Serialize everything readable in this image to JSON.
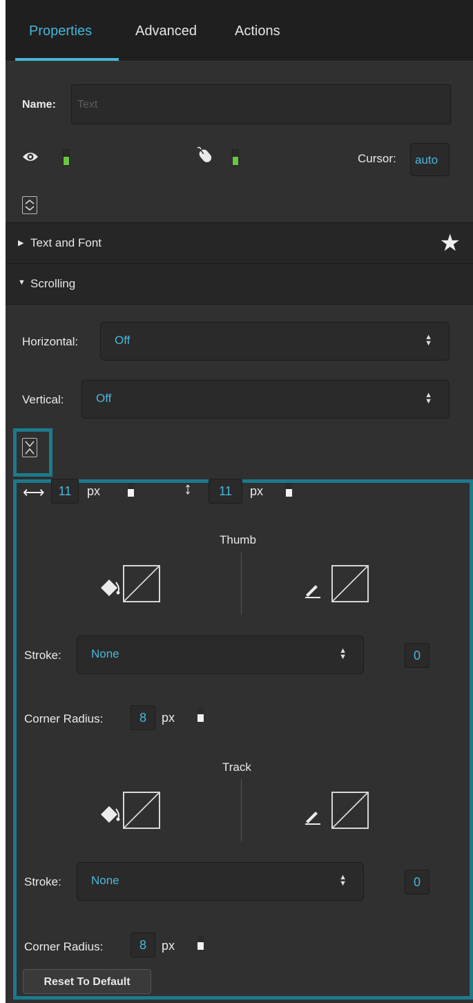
{
  "tabs": [
    {
      "label": "Properties",
      "active": true
    },
    {
      "label": "Advanced",
      "active": false
    },
    {
      "label": "Actions",
      "active": false
    }
  ],
  "name": {
    "label": "Name:",
    "placeholder": "Text"
  },
  "visibility": {
    "icon": "eye-icon",
    "toggle": "on"
  },
  "pointer": {
    "icon": "mouse-icon",
    "toggle": "on"
  },
  "cursor": {
    "label": "Cursor:",
    "value": "auto"
  },
  "sections": [
    {
      "label": "Text and Font",
      "expanded": false,
      "icon": "star-icon"
    },
    {
      "label": "Scrolling",
      "expanded": true
    }
  ],
  "scrolling": {
    "horizontal": {
      "label": "Horizontal:",
      "value": "Off"
    },
    "vertical": {
      "label": "Vertical:",
      "value": "Off"
    }
  },
  "scrollbar": {
    "width": {
      "value": "11",
      "unit": "px"
    },
    "height": {
      "value": "11",
      "unit": "px"
    },
    "thumb": {
      "title": "Thumb",
      "stroke": {
        "label": "Stroke:",
        "value": "None",
        "width": "0"
      },
      "corner_radius": {
        "label": "Corner Radius:",
        "value": "8",
        "unit": "px"
      }
    },
    "track": {
      "title": "Track",
      "stroke": {
        "label": "Stroke:",
        "value": "None",
        "width": "0"
      },
      "corner_radius": {
        "label": "Corner Radius:",
        "value": "8",
        "unit": "px"
      }
    },
    "reset_label": "Reset To Default"
  },
  "colors": {
    "accent": "#45b6d9",
    "panel": "#303030",
    "header": "#1f1f1f",
    "toggle_on": "#6cc644",
    "highlight": "#1c7a8c"
  }
}
